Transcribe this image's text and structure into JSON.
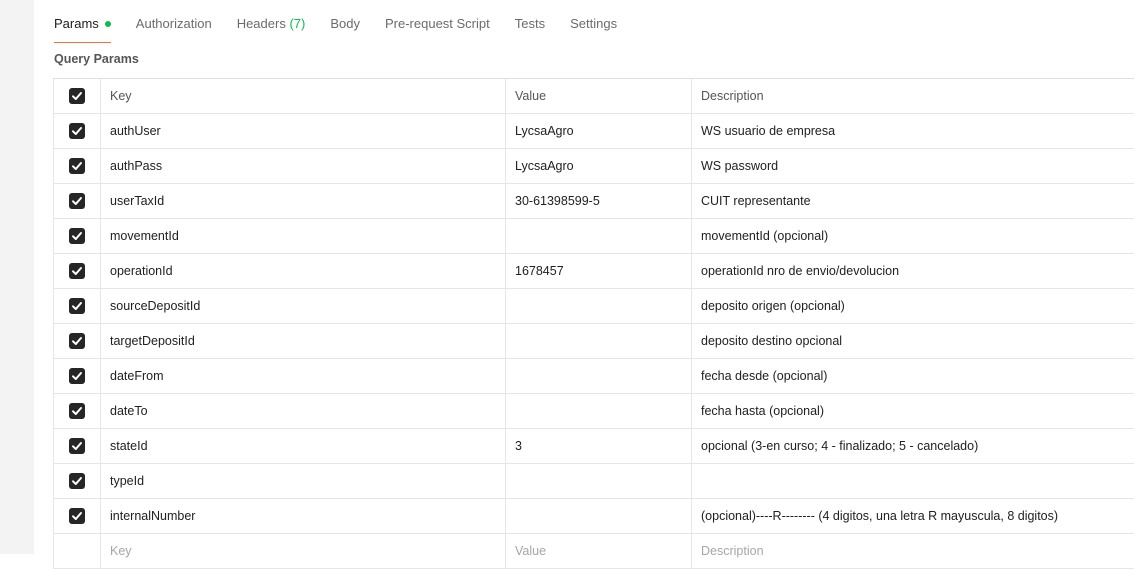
{
  "tabs": [
    {
      "label": "Params"
    },
    {
      "label": "Authorization"
    },
    {
      "label": "Headers",
      "count": "(7)"
    },
    {
      "label": "Body"
    },
    {
      "label": "Pre-request Script"
    },
    {
      "label": "Tests"
    },
    {
      "label": "Settings"
    }
  ],
  "section_title": "Query Params",
  "columns": {
    "key": "Key",
    "value": "Value",
    "description": "Description"
  },
  "rows": [
    {
      "key": "authUser",
      "value": "LycsaAgro",
      "description": "WS usuario de empresa"
    },
    {
      "key": "authPass",
      "value": "LycsaAgro",
      "description": "WS password"
    },
    {
      "key": "userTaxId",
      "value": "30-61398599-5",
      "description": "CUIT representante"
    },
    {
      "key": "movementId",
      "value": "",
      "description": "movementId (opcional)"
    },
    {
      "key": "operationId",
      "value": "1678457",
      "description": "operationId nro de envio/devolucion"
    },
    {
      "key": "sourceDepositId",
      "value": "",
      "description": "deposito origen (opcional)"
    },
    {
      "key": "targetDepositId",
      "value": "",
      "description": "deposito destino opcional"
    },
    {
      "key": "dateFrom",
      "value": "",
      "description": "fecha desde (opcional)"
    },
    {
      "key": "dateTo",
      "value": "",
      "description": "fecha hasta (opcional)"
    },
    {
      "key": "stateId",
      "value": "3",
      "description": "opcional (3-en curso; 4 - finalizado; 5 - cancelado)"
    },
    {
      "key": "typeId",
      "value": "",
      "description": ""
    },
    {
      "key": "internalNumber",
      "value": "",
      "description": "(opcional)----R-------- (4 digitos, una letra R mayuscula, 8 digitos)"
    }
  ],
  "new_row": {
    "key_placeholder": "Key",
    "value_placeholder": "Value",
    "description_placeholder": "Description"
  },
  "colors": {
    "accent": "#ff6c37",
    "green": "#0cbb52",
    "checkbox": "#262626"
  }
}
